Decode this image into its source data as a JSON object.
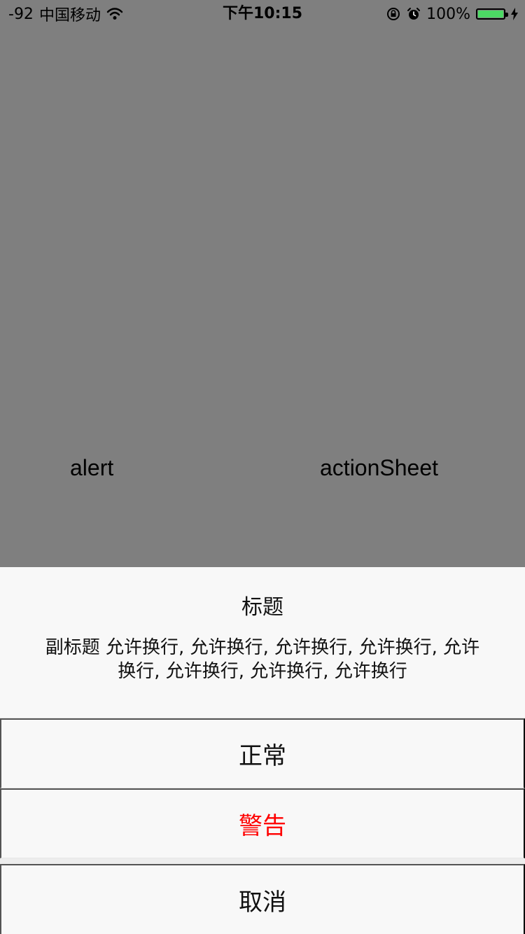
{
  "status_bar": {
    "signal": "-92",
    "carrier": "中国移动",
    "time": "下午10:15",
    "battery_percent_text": "100%",
    "icons": {
      "wifi": "wifi-icon",
      "rotation_lock": "rotation-lock-icon",
      "alarm": "alarm-icon",
      "battery": "battery-icon",
      "charging": "charging-bolt-icon"
    }
  },
  "main": {
    "alert_label": "alert",
    "action_sheet_label": "actionSheet"
  },
  "action_sheet": {
    "title": "标题",
    "subtitle": "副标题 允许换行, 允许换行, 允许换行, 允许换行, 允许换行, 允许换行, 允许换行, 允许换行",
    "items": [
      {
        "label": "正常",
        "style": "default"
      },
      {
        "label": "警告",
        "style": "destructive"
      }
    ],
    "cancel_label": "取消"
  },
  "colors": {
    "overlay_background": "#7f7f7f",
    "sheet_background": "#f8f8f8",
    "destructive": "#ff0000",
    "battery_fill": "#4cd964"
  }
}
